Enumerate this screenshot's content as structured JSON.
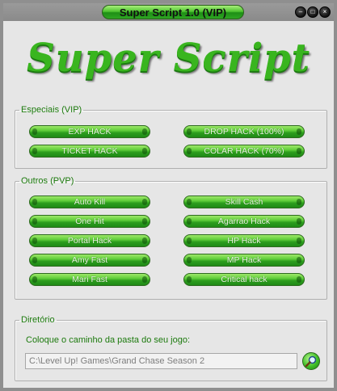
{
  "window": {
    "title": "Super Script 1.0 (VIP)"
  },
  "logo": {
    "text": "Super Script"
  },
  "vip": {
    "legend": "Especiais (VIP)",
    "buttons": [
      "EXP HACK",
      "DROP HACK (100%)",
      "TICKET HACK",
      "COLAR HACK (70%)"
    ]
  },
  "pvp": {
    "legend": "Outros (PVP)",
    "buttons": [
      "Auto Kill",
      "Skill Cash",
      "One Hit",
      "Agarrao Hack",
      "Portal Hack",
      "HP Hack",
      "Amy Fast",
      "MP Hack",
      "Mari Fast",
      "Critical hack"
    ]
  },
  "dir": {
    "legend": "Diretório",
    "hint": "Coloque o caminho da pasta do seu jogo:",
    "path_value": "C:\\Level Up! Games\\Grand Chase Season 2"
  },
  "icons": {
    "minimize": "minimize-icon",
    "maximize": "maximize-icon",
    "close": "close-icon",
    "search": "magnifier-icon"
  }
}
